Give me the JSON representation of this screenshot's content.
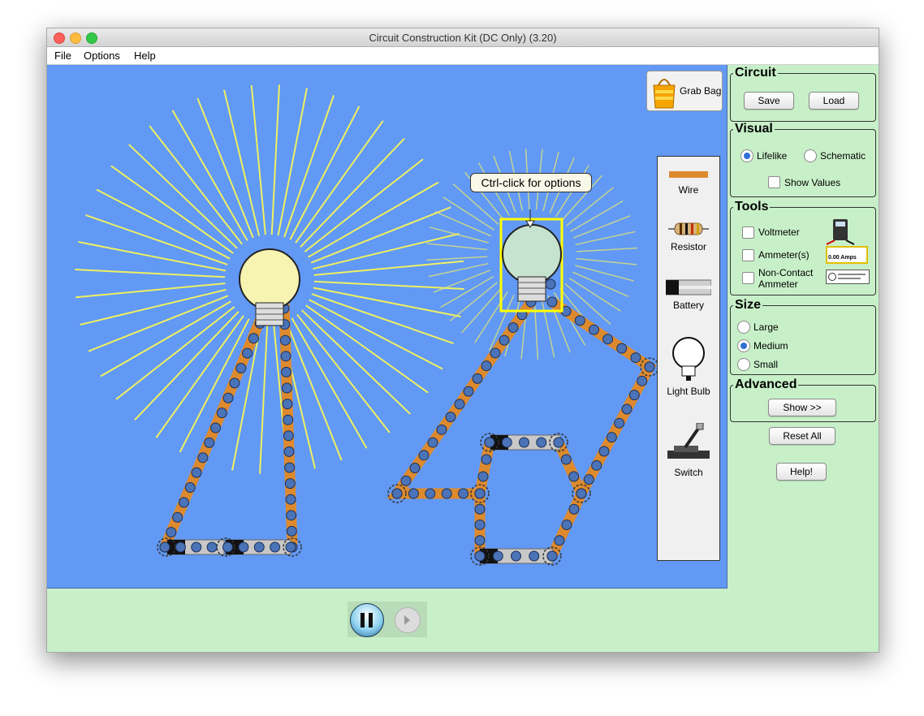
{
  "window": {
    "title": "Circuit Construction Kit (DC Only) (3.20)"
  },
  "menubar": {
    "items": [
      "File",
      "Options",
      "Help"
    ]
  },
  "canvas": {
    "grab_bag_label": "Grab Bag",
    "tooltip": "Ctrl-click for options",
    "toolbox": {
      "wire": "Wire",
      "resistor": "Resistor",
      "battery": "Battery",
      "light_bulb": "Light Bulb",
      "switch": "Switch"
    }
  },
  "panel": {
    "circuit": {
      "title": "Circuit",
      "save": "Save",
      "load": "Load"
    },
    "visual": {
      "title": "Visual",
      "lifelike": "Lifelike",
      "schematic": "Schematic",
      "show_values": "Show Values",
      "selected": "Lifelike"
    },
    "tools": {
      "title": "Tools",
      "voltmeter": "Voltmeter",
      "ammeters": "Ammeter(s)",
      "noncontact_1": "Non-Contact",
      "noncontact_2": "Ammeter",
      "ammeter_readout": "0.00 Amps"
    },
    "size": {
      "title": "Size",
      "large": "Large",
      "medium": "Medium",
      "small": "Small",
      "selected": "Medium"
    },
    "advanced": {
      "title": "Advanced",
      "show": "Show >>"
    },
    "reset_all": "Reset All",
    "help": "Help!"
  },
  "colors": {
    "canvas": "#6199f5",
    "panel": "#c8f0c8",
    "wire": "#dd8a2e",
    "light_rays": "#f0f060"
  },
  "icons": [
    "close-icon",
    "minimize-icon",
    "zoom-icon",
    "grab-bag-icon",
    "wire-icon",
    "resistor-icon",
    "battery-icon",
    "light-bulb-icon",
    "switch-icon",
    "voltmeter-icon",
    "ammeter-icon",
    "noncontact-ammeter-icon",
    "pause-icon",
    "step-icon"
  ]
}
